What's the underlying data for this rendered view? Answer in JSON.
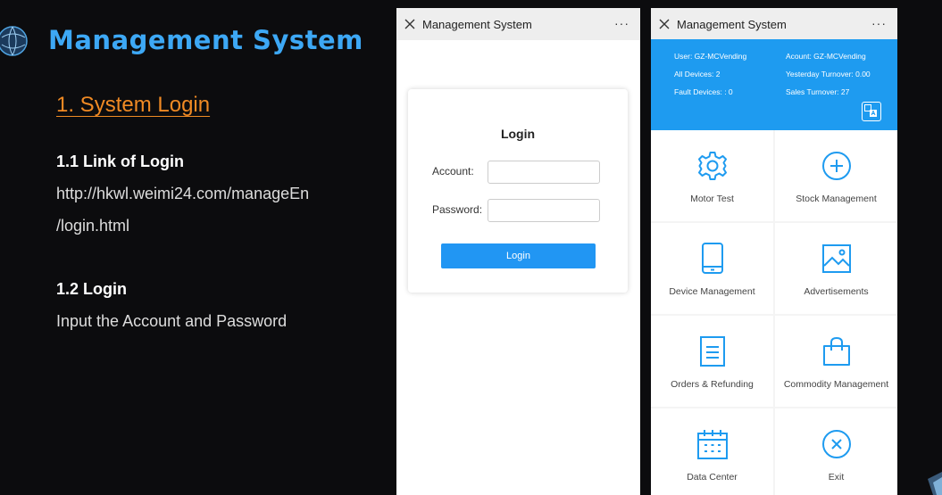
{
  "slide": {
    "title": "Management System",
    "section_title": "1. System Login",
    "sub1_title": "1.1 Link of Login",
    "sub1_line1": "http://hkwl.weimi24.com/manageEn",
    "sub1_line2": "/login.html",
    "sub2_title": "1.2 Login",
    "sub2_text": "Input the Account and Password"
  },
  "login_phone": {
    "titlebar": "Management System",
    "more": "···",
    "form_title": "Login",
    "account_label": "Account:",
    "password_label": "Password:",
    "account_value": "",
    "password_value": "",
    "button": "Login"
  },
  "menu_phone": {
    "titlebar": "Management System",
    "more": "···",
    "info": {
      "user": "User: GZ-MCVending",
      "account": "Acount: GZ-MCVending",
      "all_devices": "All Devices: 2",
      "yesterday": "Yesterday Turnover: 0.00",
      "fault": "Fault Devices: : 0",
      "sales": "Sales Turnover: 27"
    },
    "tiles": [
      {
        "label": "Motor Test",
        "icon": "gear-icon"
      },
      {
        "label": "Stock Management",
        "icon": "plus-circle-icon"
      },
      {
        "label": "Device Management",
        "icon": "tablet-icon"
      },
      {
        "label": "Advertisements",
        "icon": "image-icon"
      },
      {
        "label": "Orders & Refunding",
        "icon": "document-icon"
      },
      {
        "label": "Commodity Management",
        "icon": "shopping-bag-icon"
      },
      {
        "label": "Data Center",
        "icon": "calendar-icon"
      },
      {
        "label": "Exit",
        "icon": "close-circle-icon"
      }
    ]
  },
  "colors": {
    "title_blue": "#3da8f5",
    "section_orange": "#f08a24",
    "accent_blue": "#1e9bf0",
    "button_blue": "#2196f3"
  }
}
